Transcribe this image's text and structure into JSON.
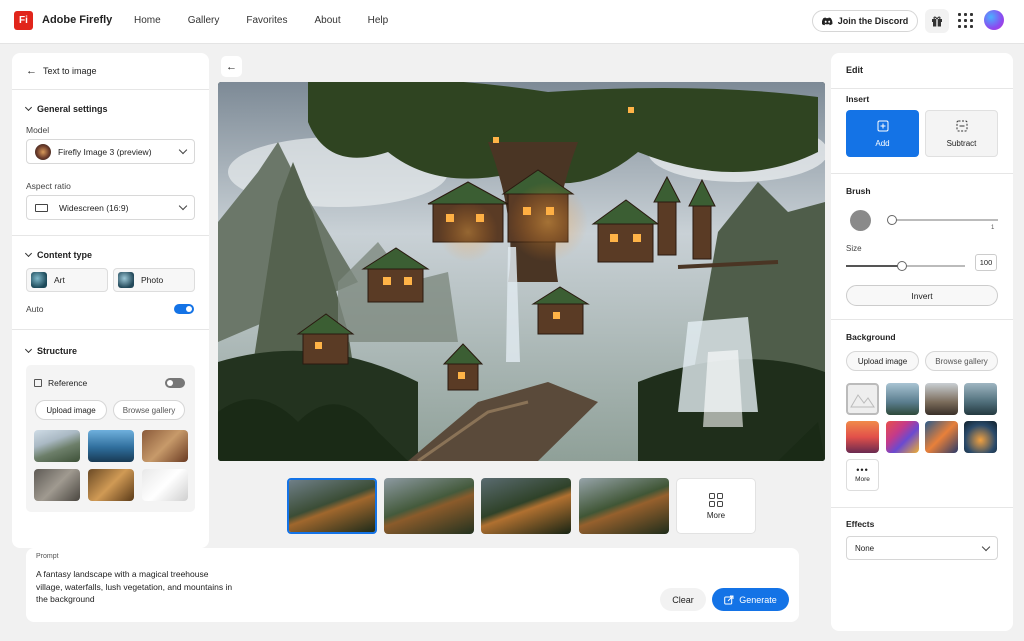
{
  "app": {
    "logo": "Fi",
    "name": "Adobe Firefly"
  },
  "nav": {
    "home": "Home",
    "gallery": "Gallery",
    "favorites": "Favorites",
    "about": "About",
    "help": "Help"
  },
  "header": {
    "discord": "Join the Discord"
  },
  "left": {
    "back_title": "Text to image",
    "general": {
      "title": "General settings",
      "model_label": "Model",
      "model_value": "Firefly Image 3 (preview)",
      "aspect_label": "Aspect ratio",
      "aspect_value": "Widescreen (16:9)"
    },
    "content": {
      "title": "Content type",
      "art": "Art",
      "photo": "Photo",
      "auto": "Auto",
      "auto_on": true
    },
    "structure": {
      "title": "Structure",
      "reference": "Reference",
      "reference_on": false,
      "upload": "Upload image",
      "browse": "Browse gallery"
    }
  },
  "variations": {
    "more": "More"
  },
  "prompt": {
    "label": "Prompt",
    "text": "A fantasy landscape with a magical treehouse village, waterfalls, lush vegetation, and mountains in the background",
    "clear": "Clear",
    "generate": "Generate"
  },
  "right": {
    "edit": "Edit",
    "insert": {
      "title": "Insert",
      "add": "Add",
      "subtract": "Subtract"
    },
    "brush": {
      "title": "Brush",
      "hardness_max": "1",
      "size_label": "Size",
      "size_value": "100",
      "invert": "Invert",
      "hardness_level": 0.05,
      "size_level": 0.45
    },
    "background": {
      "title": "Background",
      "upload": "Upload image",
      "browse": "Browse gallery",
      "more": "More"
    },
    "effects": {
      "title": "Effects",
      "value": "None"
    }
  },
  "colors": {
    "accent": "#1473e6",
    "brand": "#e1251b"
  }
}
